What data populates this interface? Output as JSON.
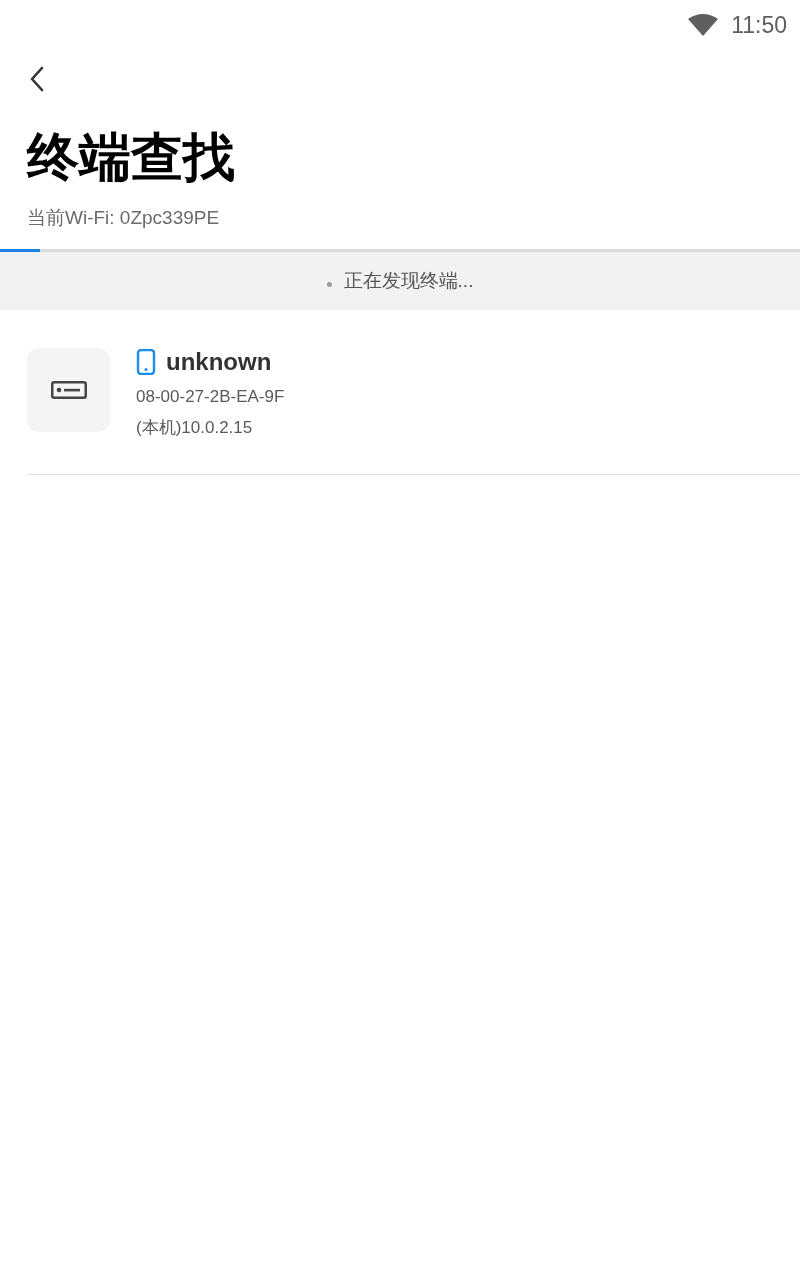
{
  "status_bar": {
    "time": "11:50"
  },
  "header": {
    "title": "终端查找",
    "wifi": "当前Wi-Fi: 0Zpc339PE"
  },
  "scan": {
    "level": 0.05,
    "message": "正在发现终端..."
  },
  "devices": [
    {
      "kind": "phone",
      "name": "unknown",
      "mac": "08-00-27-2B-EA-9F",
      "ip": "(本机)10.0.2.15"
    }
  ]
}
